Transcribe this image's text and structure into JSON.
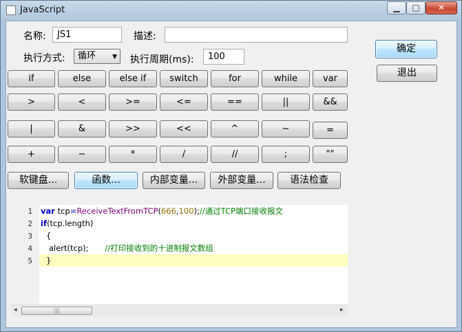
{
  "window": {
    "title": "JavaScript",
    "min_label": "▁",
    "max_label": "□",
    "close_label": "✕"
  },
  "form": {
    "name_label": "名称:",
    "name_value": "JS1",
    "desc_label": "描述:",
    "desc_value": "",
    "mode_label": "执行方式:",
    "mode_value": "循环",
    "period_label": "执行周期(ms):",
    "period_value": "100"
  },
  "actions": {
    "ok": "确定",
    "exit": "退出"
  },
  "keypad": [
    [
      "if",
      "else",
      "else if",
      "switch",
      "for",
      "while",
      "var"
    ],
    [
      ">",
      "<",
      ">=",
      "<=",
      "==",
      "||",
      "&&"
    ],
    [
      "|",
      "&",
      ">>",
      "<<",
      "^",
      "~",
      "="
    ],
    [
      "+",
      "−",
      "*",
      "/",
      "//",
      ";",
      "\"\""
    ]
  ],
  "toolbar": [
    "软键盘...",
    "函数...",
    "内部变量...",
    "外部变量...",
    "语法检查"
  ],
  "editor": {
    "line_numbers": [
      "1",
      "2",
      "3",
      "4",
      "5"
    ],
    "line1": {
      "kw": "var",
      "a": " tcp",
      "eq": "=",
      "fn": "ReceiveTextFromTCP",
      "p1": "(",
      "n1": "666",
      "c": ",",
      "n2": "100",
      "p2": ");",
      "cm": "//通过TCP端口接收报文"
    },
    "line2": {
      "kw": "if",
      "rest": "(tcp.length)"
    },
    "line3": {
      "text": "{"
    },
    "line4": {
      "code": "alert(tcp);",
      "cm": "//打印接收到的十进制报文数组"
    },
    "line5": {
      "text": "}"
    }
  },
  "scrollbar": {
    "left": "◂",
    "right": "▸",
    "grip": "|||"
  }
}
